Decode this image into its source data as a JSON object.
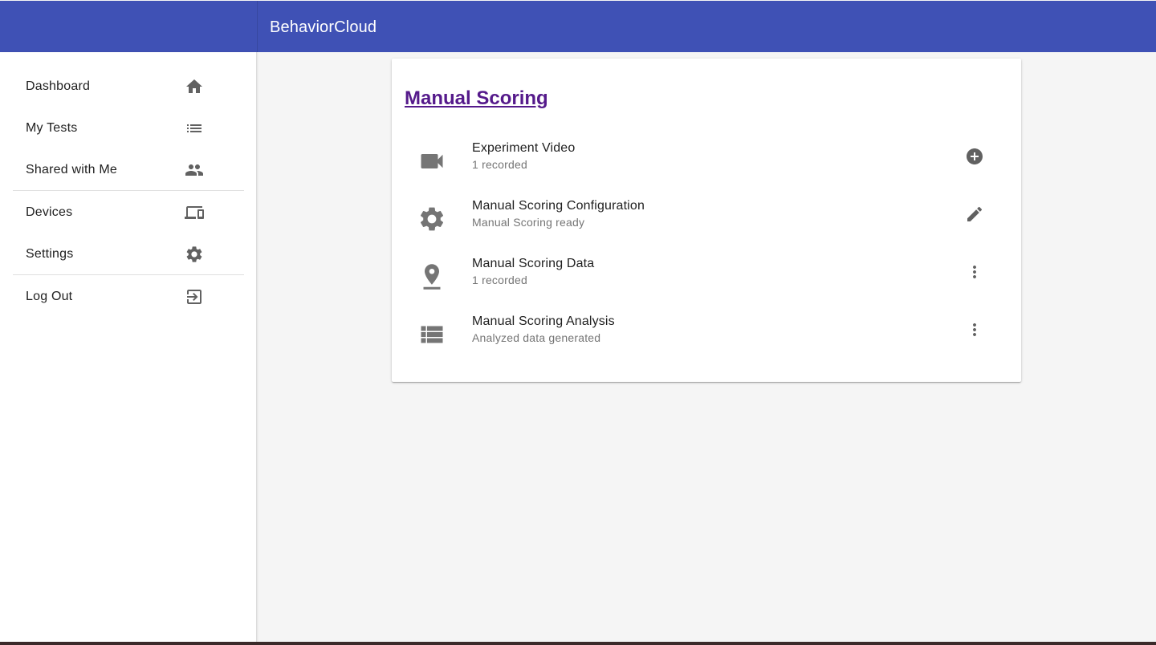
{
  "app": {
    "title": "BehaviorCloud"
  },
  "sidebar": {
    "items": [
      {
        "label": "Dashboard",
        "icon": "home-icon"
      },
      {
        "label": "My Tests",
        "icon": "list-icon"
      },
      {
        "label": "Shared with Me",
        "icon": "people-icon"
      },
      {
        "label": "Devices",
        "icon": "devices-icon"
      },
      {
        "label": "Settings",
        "icon": "gear-icon"
      },
      {
        "label": "Log Out",
        "icon": "logout-icon"
      }
    ]
  },
  "main": {
    "card_title": "Manual Scoring",
    "rows": [
      {
        "primary": "Experiment Video",
        "secondary": "1 recorded",
        "icon": "videocam-icon",
        "action_icon": "add-circle-icon"
      },
      {
        "primary": "Manual Scoring Configuration",
        "secondary": "Manual Scoring ready",
        "icon": "gear-icon",
        "action_icon": "edit-pencil-icon"
      },
      {
        "primary": "Manual Scoring Data",
        "secondary": "1 recorded",
        "icon": "location-pin-icon",
        "action_icon": "more-vert-icon"
      },
      {
        "primary": "Manual Scoring Analysis",
        "secondary": "Analyzed data generated",
        "icon": "table-list-icon",
        "action_icon": "more-vert-icon"
      }
    ]
  },
  "colors": {
    "app_bar": "#3f51b5",
    "link": "#551a8b",
    "icon": "#757575",
    "background": "#f5f5f5"
  }
}
